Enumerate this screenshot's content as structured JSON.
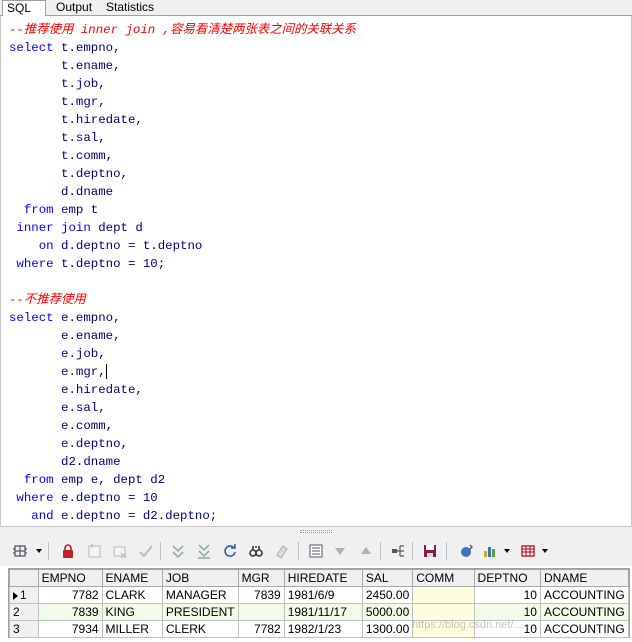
{
  "tabs": [
    {
      "label": "SQL",
      "active": true
    },
    {
      "label": "Output",
      "active": false
    },
    {
      "label": "Statistics",
      "active": false
    }
  ],
  "editor": {
    "lines": [
      [
        {
          "t": "--推荐使用 inner join ,容易看清楚两张表之间的关联关系",
          "c": "cmt"
        }
      ],
      [
        {
          "t": "select",
          "c": "kw"
        },
        {
          "t": " t.empno,",
          "c": "id"
        }
      ],
      [
        {
          "t": "       t.ename,",
          "c": "id"
        }
      ],
      [
        {
          "t": "       t.job,",
          "c": "id"
        }
      ],
      [
        {
          "t": "       t.mgr,",
          "c": "id"
        }
      ],
      [
        {
          "t": "       t.hiredate,",
          "c": "id"
        }
      ],
      [
        {
          "t": "       t.sal,",
          "c": "id"
        }
      ],
      [
        {
          "t": "       t.comm,",
          "c": "id"
        }
      ],
      [
        {
          "t": "       t.deptno,",
          "c": "id"
        }
      ],
      [
        {
          "t": "       d.dname",
          "c": "id"
        }
      ],
      [
        {
          "t": "  from",
          "c": "kw"
        },
        {
          "t": " emp t",
          "c": "id"
        }
      ],
      [
        {
          "t": " inner join",
          "c": "kw"
        },
        {
          "t": " dept d",
          "c": "id"
        }
      ],
      [
        {
          "t": "    on",
          "c": "kw"
        },
        {
          "t": " d.deptno = t.deptno",
          "c": "id"
        }
      ],
      [
        {
          "t": " where",
          "c": "kw"
        },
        {
          "t": " t.deptno = 10;",
          "c": "id"
        }
      ],
      [
        {
          "t": "",
          "c": "id"
        }
      ],
      [
        {
          "t": "--不推荐使用",
          "c": "cmt"
        }
      ],
      [
        {
          "t": "select",
          "c": "kw"
        },
        {
          "t": " e.empno,",
          "c": "id"
        }
      ],
      [
        {
          "t": "       e.ename,",
          "c": "id"
        }
      ],
      [
        {
          "t": "       e.job,",
          "c": "id"
        }
      ],
      [
        {
          "t": "       e.mgr,",
          "c": "id"
        },
        {
          "t": "",
          "c": "caret"
        }
      ],
      [
        {
          "t": "       e.hiredate,",
          "c": "id"
        }
      ],
      [
        {
          "t": "       e.sal,",
          "c": "id"
        }
      ],
      [
        {
          "t": "       e.comm,",
          "c": "id"
        }
      ],
      [
        {
          "t": "       e.deptno,",
          "c": "id"
        }
      ],
      [
        {
          "t": "       d2.dname",
          "c": "id"
        }
      ],
      [
        {
          "t": "  from",
          "c": "kw"
        },
        {
          "t": " emp e, dept d2",
          "c": "id"
        }
      ],
      [
        {
          "t": " where",
          "c": "kw"
        },
        {
          "t": " e.deptno = 10",
          "c": "id"
        }
      ],
      [
        {
          "t": "   and",
          "c": "kw"
        },
        {
          "t": " e.deptno = d2.deptno;",
          "c": "id"
        }
      ]
    ]
  },
  "toolbar": {
    "icons": [
      "grid-menu-icon",
      "lock-icon",
      "add-record-icon",
      "delete-record-icon",
      "post-changes-icon",
      "fetch-next-icon",
      "fetch-all-icon",
      "refresh-icon",
      "query-by-example-icon",
      "clear-icon",
      "single-record-view-icon",
      "sort-desc-icon",
      "sort-asc-icon",
      "export-tree-icon",
      "save-icon",
      "link-icon",
      "chart-icon",
      "table-export-icon"
    ]
  },
  "grid": {
    "columns": [
      "EMPNO",
      "ENAME",
      "JOB",
      "MGR",
      "HIREDATE",
      "SAL",
      "COMM",
      "DEPTNO",
      "DNAME"
    ],
    "rows": [
      {
        "n": "1",
        "selected": true,
        "cells": [
          "7782",
          "CLARK",
          "MANAGER",
          "7839",
          "1981/6/9",
          "2450.00",
          "",
          "10",
          "ACCOUNTING"
        ]
      },
      {
        "n": "2",
        "selected": false,
        "cells": [
          "7839",
          "KING",
          "PRESIDENT",
          "",
          "1981/11/17",
          "5000.00",
          "",
          "10",
          "ACCOUNTING"
        ]
      },
      {
        "n": "3",
        "selected": false,
        "cells": [
          "7934",
          "MILLER",
          "CLERK",
          "7782",
          "1982/1/23",
          "1300.00",
          "",
          "10",
          "ACCOUNTING"
        ]
      }
    ]
  },
  "watermark": "https://blog.csdn.net/..."
}
